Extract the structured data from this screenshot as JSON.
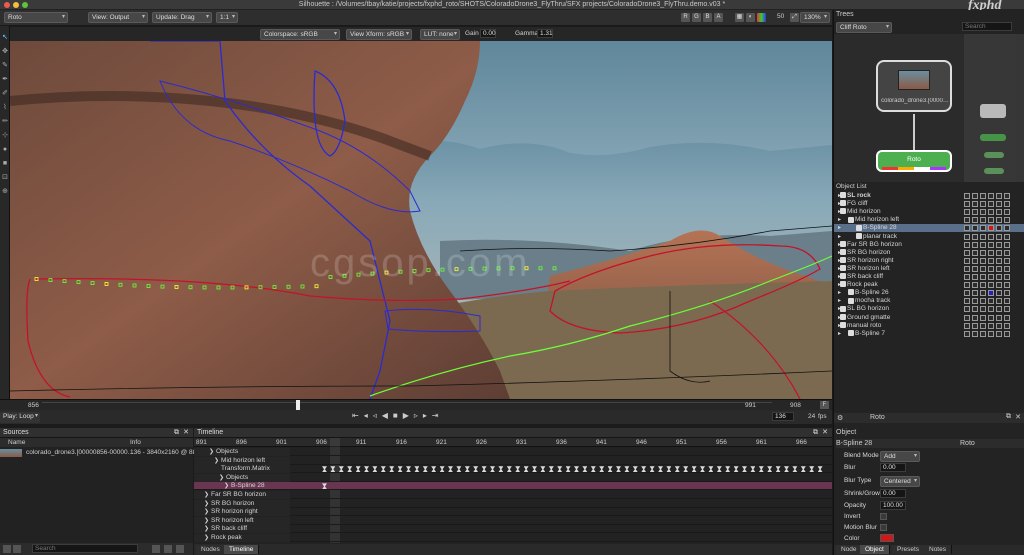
{
  "window": {
    "title": "Silhouette : /Volumes/tbay/katie/projects/fxphd_roto/SHOTS/ColoradoDrone3_FlyThru/SFX projects/ColoradoDrone3_FlyThru.demo.v03 *",
    "logo": "fxphd",
    "watermark": "cgsop.com"
  },
  "toolbar": {
    "mode": "Roto",
    "view": "View: Output",
    "update": "Update: Drag",
    "ratio": "1:1",
    "zoom": "130%",
    "frame_num": "50"
  },
  "viewer_bar": {
    "colorspace": "Colorspace: sRGB",
    "view_xform": "View Xform: sRGB",
    "lut": "LUT: none",
    "gain_label": "Gain",
    "gain_value": "0.00",
    "gamma_label": "Gamma",
    "gamma_value": "1.31"
  },
  "scrubber": {
    "start": "856",
    "end": "908",
    "out": "991",
    "f_label": "F"
  },
  "transport": {
    "play_mode": "Play: Loop",
    "current_frame": "136",
    "fps": "24",
    "fps_label": "fps"
  },
  "sources": {
    "title": "Sources",
    "col_name": "Name",
    "col_info": "Info",
    "item_name": "colorado_drone3.[00000856-00000…",
    "item_info": "136 - 3840x2160 @ 88",
    "search_placeholder": "Search"
  },
  "timeline": {
    "title": "Timeline",
    "ticks": [
      "891",
      "896",
      "901",
      "906",
      "911",
      "916",
      "921",
      "926",
      "931",
      "936",
      "941",
      "946",
      "951",
      "956",
      "961",
      "966"
    ],
    "rows": [
      {
        "label": "Objects",
        "indent": 3
      },
      {
        "label": "Mid horizon left",
        "indent": 4
      },
      {
        "label": "Transform.Matrix",
        "indent": 5
      },
      {
        "label": "Objects",
        "indent": 5
      },
      {
        "label": "B-Spline 28",
        "indent": 6
      },
      {
        "label": "Far SR BG horizon",
        "indent": 2
      },
      {
        "label": "SR BG horizon",
        "indent": 2
      },
      {
        "label": "SR horizon right",
        "indent": 2
      },
      {
        "label": "SR horizon left",
        "indent": 2
      },
      {
        "label": "SR back cliff",
        "indent": 2
      },
      {
        "label": "Rock peak",
        "indent": 2
      }
    ],
    "tabs": [
      "Nodes",
      "Timeline"
    ]
  },
  "trees": {
    "title": "Trees",
    "tree_name": "Cliff Roto",
    "search_placeholder": "Search",
    "source_node": "colorado_drone3.[0000…",
    "roto_node": "Roto"
  },
  "object_list": {
    "title": "Object List",
    "items": [
      {
        "label": "SL rock",
        "indent": 0,
        "bold": true
      },
      {
        "label": "FG cliff",
        "indent": 0
      },
      {
        "label": "Mid horizon",
        "indent": 0
      },
      {
        "label": "Mid horizon left",
        "indent": 1
      },
      {
        "label": "B-Spline 28",
        "indent": 2,
        "selected": true
      },
      {
        "label": "planar track",
        "indent": 2
      },
      {
        "label": "Far SR BG horizon",
        "indent": 0
      },
      {
        "label": "SR BG horizon",
        "indent": 0
      },
      {
        "label": "SR horizon right",
        "indent": 0
      },
      {
        "label": "SR horizon left",
        "indent": 0
      },
      {
        "label": "SR back cliff",
        "indent": 0
      },
      {
        "label": "Rock peak",
        "indent": 0
      },
      {
        "label": "B-Spline 26",
        "indent": 1
      },
      {
        "label": "mocha track",
        "indent": 1
      },
      {
        "label": "SL BG horizon",
        "indent": 0
      },
      {
        "label": "Ground gmatte",
        "indent": 0
      },
      {
        "label": "manual roto",
        "indent": 0
      },
      {
        "label": "B-Spline 7",
        "indent": 1
      }
    ]
  },
  "object_panel": {
    "node_title": "Roto",
    "title": "Object",
    "object_name": "B-Spline 28",
    "object_node": "Roto",
    "props": {
      "blend_mode_label": "Blend Mode",
      "blend_mode_value": "Add",
      "blur_label": "Blur",
      "blur_value": "0.00",
      "blur_type_label": "Blur Type",
      "blur_type_value": "Centered",
      "shrink_label": "Shrink/Grow",
      "shrink_value": "0.00",
      "opacity_label": "Opacity",
      "opacity_value": "100.00",
      "invert_label": "Invert",
      "motion_blur_label": "Motion Blur",
      "color_label": "Color"
    },
    "tabs": [
      "Node",
      "Object",
      "Presets",
      "Notes"
    ]
  },
  "colors": {
    "accent": "#4caf50",
    "roto_red": "#d0122a",
    "roto_blue": "#2a2ad6",
    "roto_green": "#6cff3a",
    "selected_row": "#6a3550",
    "color_swatch": "#d01818"
  }
}
